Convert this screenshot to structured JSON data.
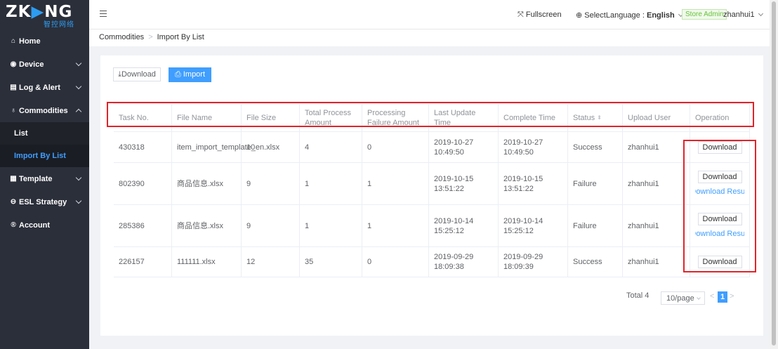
{
  "brand": {
    "logo_text": "ZKONG",
    "logo_sub": "智控网络",
    "accent_color": "#2d9cf0"
  },
  "sidebar": {
    "items": [
      {
        "label": "Home",
        "icon": "home-icon"
      },
      {
        "label": "Device",
        "icon": "device-icon"
      },
      {
        "label": "Log & Alert",
        "icon": "log-icon"
      },
      {
        "label": "Commodities",
        "icon": "bag-icon",
        "expanded": true
      },
      {
        "label": "Template",
        "icon": "template-icon"
      },
      {
        "label": "ESL Strategy",
        "icon": "strategy-icon"
      },
      {
        "label": "Account",
        "icon": "account-icon"
      }
    ],
    "sub_items": [
      "List",
      "Import By List"
    ],
    "active_sub": "Import By List"
  },
  "topbar": {
    "fullscreen": "Fullscreen",
    "language_label": "SelectLanguage :",
    "language_value": "English",
    "role": "Store Admin",
    "username": "zhanhui1"
  },
  "breadcrumb": {
    "root": "Commodities",
    "current": "Import By List"
  },
  "toolbar": {
    "download": "Download",
    "import": "Import"
  },
  "table": {
    "headers": [
      "Task No.",
      "File Name",
      "File Size",
      "Total Process Amount",
      "Processing Failure Amount",
      "Last Update Time",
      "Complete Time",
      "Status",
      "Upload User",
      "Operation"
    ],
    "rows": [
      {
        "task_no": "430318",
        "file_name": "item_import_template_en.xlsx",
        "file_size": "10",
        "total": "4",
        "failure": "0",
        "last_update": "2019-10-27 10:49:50",
        "complete": "2019-10-27 10:49:50",
        "status": "Success",
        "user": "zhanhui1",
        "op_button": "Download",
        "op_link": ""
      },
      {
        "task_no": "802390",
        "file_name": "商品信息.xlsx",
        "file_size": "9",
        "total": "1",
        "failure": "1",
        "last_update": "2019-10-15 13:51:22",
        "complete": "2019-10-15 13:51:22",
        "status": "Failure",
        "user": "zhanhui1",
        "op_button": "Download",
        "op_link": "Download Result"
      },
      {
        "task_no": "285386",
        "file_name": "商品信息.xlsx",
        "file_size": "9",
        "total": "1",
        "failure": "1",
        "last_update": "2019-10-14 15:25:12",
        "complete": "2019-10-14 15:25:12",
        "status": "Failure",
        "user": "zhanhui1",
        "op_button": "Download",
        "op_link": "Download Result"
      },
      {
        "task_no": "226157",
        "file_name": "111111.xlsx",
        "file_size": "12",
        "total": "35",
        "failure": "0",
        "last_update": "2019-09-29 18:09:38",
        "complete": "2019-09-29 18:09:39",
        "status": "Success",
        "user": "zhanhui1",
        "op_button": "Download",
        "op_link": ""
      }
    ]
  },
  "pagination": {
    "total": "Total 4",
    "page_size": "10/page",
    "current_page": "1"
  },
  "colors": {
    "primary": "#409eff",
    "sidebar_bg": "#2b2f3a",
    "highlight": "#e0242b",
    "success_tag": "#67c23a"
  }
}
